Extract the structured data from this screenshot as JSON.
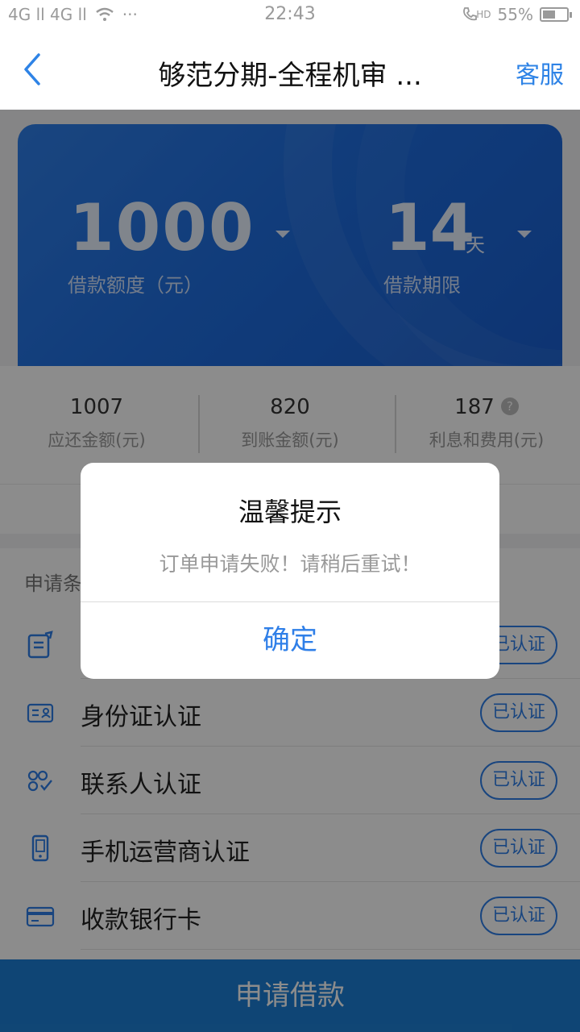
{
  "status_bar": {
    "left_text": "4G ll 4G ll",
    "dots": "···",
    "time": "22:43",
    "hd": "HD",
    "battery_percent": "55%",
    "battery_level": 0.55
  },
  "navbar": {
    "title": "够范分期-全程机审 ...",
    "service_label": "客服"
  },
  "loan_card": {
    "amount": "1000",
    "amount_caption": "借款额度（元）",
    "days": "14",
    "days_unit": "天",
    "days_caption": "借款期限",
    "accent_color": "#2f7fe8"
  },
  "summary": {
    "repay_value": "1007",
    "repay_label": "应还金额(元)",
    "received_value": "820",
    "received_label": "到账金额(元)",
    "fee_value": "187",
    "fee_label": "利息和费用(元)",
    "help_icon": "?"
  },
  "conditions": {
    "header": "申请条件",
    "badge_label": "已认证",
    "items": [
      {
        "label": "",
        "icon": "edit-document-icon"
      },
      {
        "label": "身份证认证",
        "icon": "id-card-icon"
      },
      {
        "label": "联系人认证",
        "icon": "contacts-icon"
      },
      {
        "label": "手机运营商认证",
        "icon": "phone-icon"
      },
      {
        "label": "收款银行卡",
        "icon": "bank-card-icon"
      }
    ]
  },
  "apply_button": "申请借款",
  "dialog": {
    "title": "温馨提示",
    "message": "订单申请失败！请稍后重试！",
    "confirm": "确定"
  }
}
